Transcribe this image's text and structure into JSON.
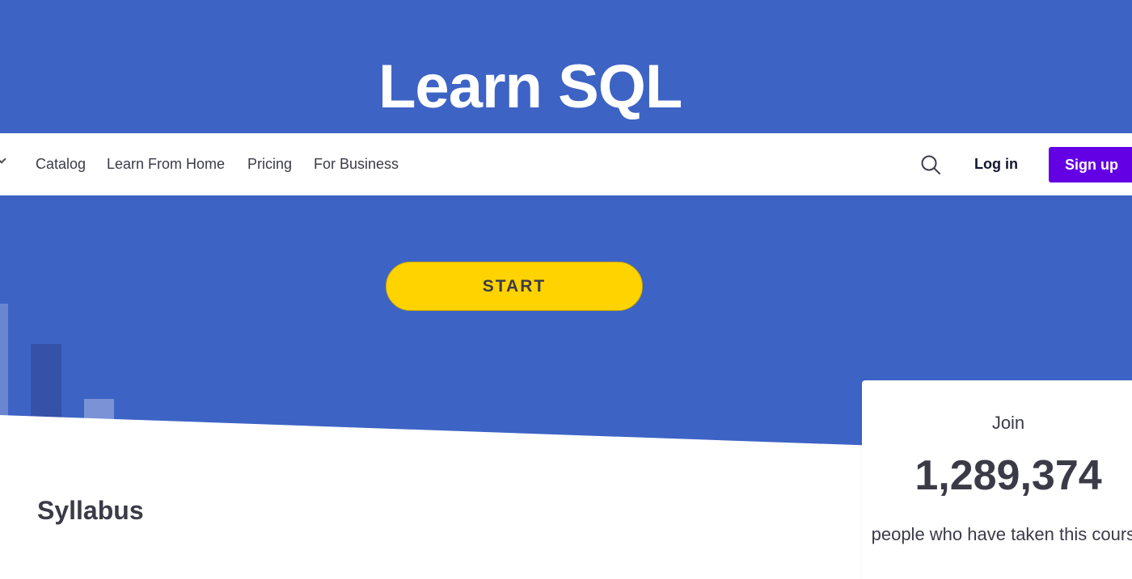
{
  "hero": {
    "title": "Learn SQL",
    "start_label": "START",
    "background_color": "#3d63c5"
  },
  "nav": {
    "links": [
      {
        "label": "Catalog"
      },
      {
        "label": "Learn From Home"
      },
      {
        "label": "Pricing"
      },
      {
        "label": "For Business"
      }
    ],
    "search_icon": "search-icon",
    "login_label": "Log in",
    "signup_label": "Sign up",
    "signup_color": "#6400e4"
  },
  "main": {
    "syllabus_heading": "Syllabus"
  },
  "join_card": {
    "label": "Join",
    "count": "1,289,374",
    "description": "people who have taken this course"
  },
  "colors": {
    "accent_yellow": "#ffd300",
    "text_dark": "#3b3b48"
  }
}
